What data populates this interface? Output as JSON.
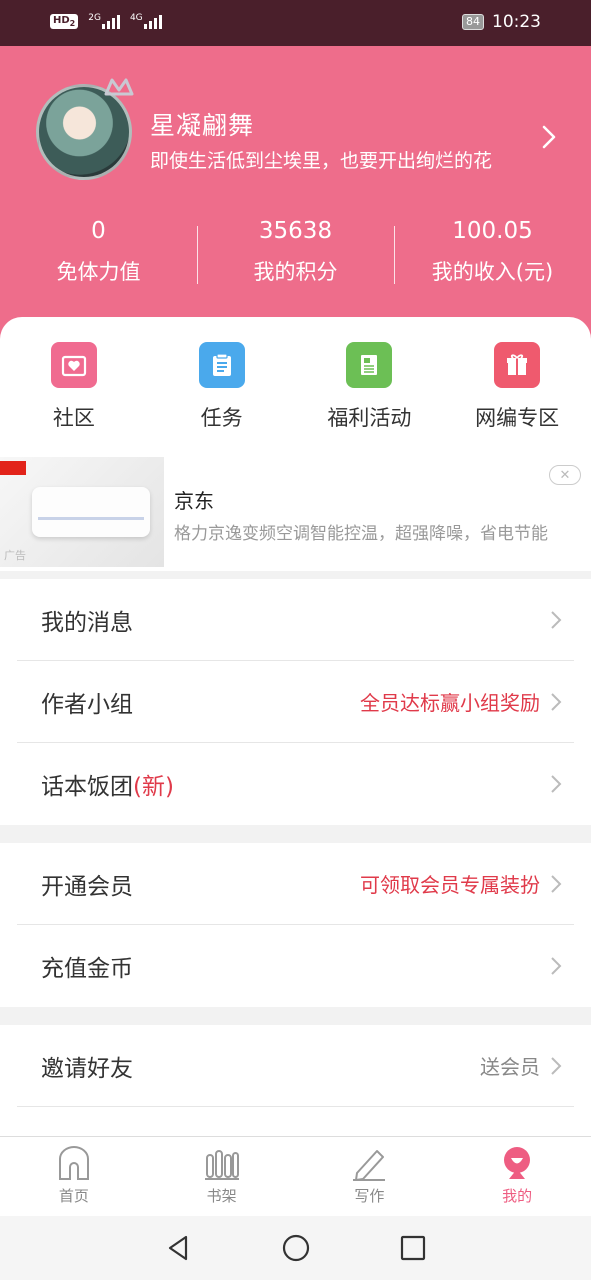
{
  "status_bar": {
    "hd": "HD",
    "hd_sub": "2",
    "signal1_label": "2G",
    "signal2_label": "4G",
    "battery": "84",
    "time": "10:23"
  },
  "profile": {
    "name": "星凝翩舞",
    "signature": "即使生活低到尘埃里，也要开出绚烂的花",
    "stats": [
      {
        "value": "0",
        "label": "免体力值"
      },
      {
        "value": "35638",
        "label": "我的积分"
      },
      {
        "value": "100.05",
        "label": "我的收入(元)"
      }
    ]
  },
  "quick_actions": [
    {
      "label": "社区",
      "color": "#f06b90",
      "icon": "heart-box-icon"
    },
    {
      "label": "任务",
      "color": "#4aa9ec",
      "icon": "clipboard-icon"
    },
    {
      "label": "福利活动",
      "color": "#6cbf55",
      "icon": "document-icon"
    },
    {
      "label": "网编专区",
      "color": "#ef5a6e",
      "icon": "gift-icon"
    }
  ],
  "ad": {
    "title": "京东",
    "description": "格力京逸变频空调智能控温，超强降噪，省电节能",
    "label": "广告"
  },
  "menu_group_1": [
    {
      "label": "我的消息",
      "hint": ""
    },
    {
      "label": "作者小组",
      "hint": "全员达标赢小组奖励"
    },
    {
      "label": "话本饭团",
      "label_new": "(新)",
      "hint": ""
    }
  ],
  "menu_group_2": [
    {
      "label": "开通会员",
      "hint": "可领取会员专属装扮"
    },
    {
      "label": "充值金币",
      "hint": ""
    }
  ],
  "menu_group_3": [
    {
      "label": "邀请好友",
      "hint": "送会员"
    }
  ],
  "tabbar": [
    {
      "label": "首页",
      "icon": "home-icon",
      "active": false
    },
    {
      "label": "书架",
      "icon": "bookshelf-icon",
      "active": false
    },
    {
      "label": "写作",
      "icon": "pencil-icon",
      "active": false
    },
    {
      "label": "我的",
      "icon": "profile-icon",
      "active": true
    }
  ],
  "colors": {
    "header": "#ee6d8b",
    "status_bar": "#4a1f2b",
    "accent_red": "#e03a4a",
    "active_tab": "#ee5d82"
  }
}
